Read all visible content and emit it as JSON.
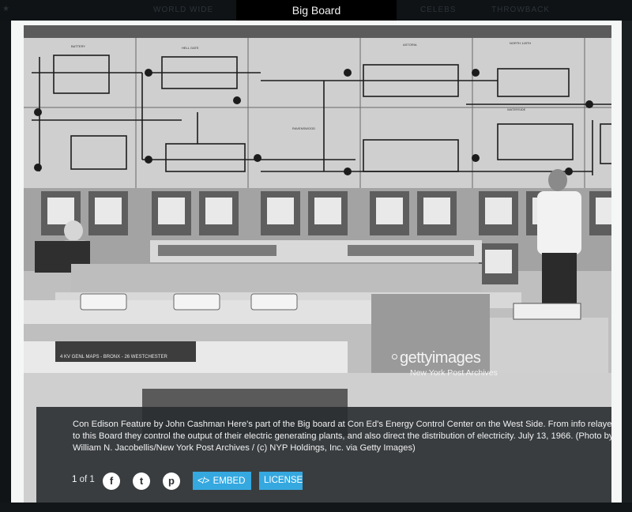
{
  "tabs": {
    "left": "WORLD WIDE",
    "active": "Big Board",
    "right1": "CELEBS",
    "right2": "THROWBACK"
  },
  "photo": {
    "watermark_brand": "gettyimages",
    "watermark_credit": "New York Post Archives",
    "board_label_1": "BATTERY",
    "board_label_2": "ASTORIA",
    "board_label_3": "NORTH 149TH",
    "board_label_4": "HELL GATE",
    "board_label_5": "RAVENSWOOD",
    "board_label_6": "WATERSIDE",
    "desk_plate": "4 KV GENL MAPS - BRONX - 26 WESTCHESTER"
  },
  "caption": {
    "text": "Con Edison Feature by John Cashman Here's part of the Big board at Con Ed's Energy Control Center on the West Side. From info relayed to this Board they control the output of their electric generating plants, and also direct the distribution of electricity. July 13, 1966. (Photo by William N. Jacobellis/New York Post Archives / (c) NYP Holdings, Inc. via Getty Images)",
    "current": "1",
    "of_word": "of",
    "total": "1"
  },
  "actions": {
    "facebook_glyph": "f",
    "twitter_glyph": "t",
    "pinterest_glyph": "p",
    "embed_glyph": "</>",
    "embed_label": "EMBED",
    "license_label": "LICENSE"
  },
  "asset_id": "538215446",
  "colors": {
    "accent": "#35a8e0",
    "panel": "#282c30",
    "tab_active": "#000000"
  },
  "icons": [
    "facebook-icon",
    "twitter-icon",
    "pinterest-icon",
    "code-icon",
    "getty-logo"
  ]
}
